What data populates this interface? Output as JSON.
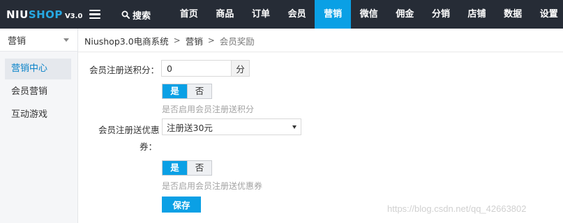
{
  "header": {
    "logo_main_left": "NIU",
    "logo_main_right": "SHOP",
    "logo_version": "V3.0",
    "search_label": "搜索",
    "nav": [
      {
        "label": "首页",
        "active": false
      },
      {
        "label": "商品",
        "active": false
      },
      {
        "label": "订单",
        "active": false
      },
      {
        "label": "会员",
        "active": false
      },
      {
        "label": "营销",
        "active": true
      },
      {
        "label": "微信",
        "active": false
      },
      {
        "label": "佣金",
        "active": false
      },
      {
        "label": "分销",
        "active": false
      },
      {
        "label": "店铺",
        "active": false
      },
      {
        "label": "数据",
        "active": false
      },
      {
        "label": "设置",
        "active": false
      }
    ],
    "accent_color": "#0aa0e5",
    "bar_color": "#262c36"
  },
  "sidebar": {
    "section": "营销",
    "items": [
      {
        "label": "营销中心",
        "active": true
      },
      {
        "label": "会员营销",
        "active": false
      },
      {
        "label": "互动游戏",
        "active": false
      }
    ]
  },
  "breadcrumb": [
    "Niushop3.0电商系统",
    "营销",
    "会员奖励"
  ],
  "form": {
    "points": {
      "label": "会员注册送积分：",
      "value": "0",
      "unit": "分",
      "toggle_yes": "是",
      "toggle_no": "否",
      "selected": "是",
      "help": "是否启用会员注册送积分"
    },
    "coupon": {
      "label_line1": "会员注册送优惠",
      "label_line2": "券：",
      "selected_option": "注册送30元",
      "toggle_yes": "是",
      "toggle_no": "否",
      "selected": "是",
      "help": "是否启用会员注册送优惠券"
    },
    "save_label": "保存"
  },
  "watermark": "https://blog.csdn.net/qq_42663802"
}
